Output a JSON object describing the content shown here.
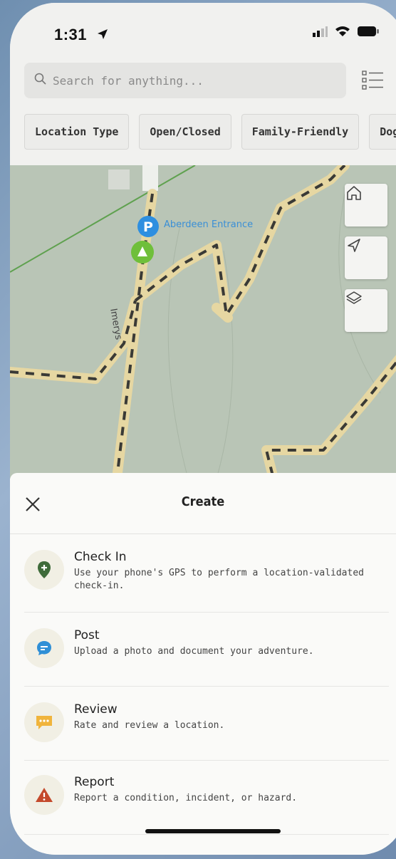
{
  "status": {
    "time": "1:31"
  },
  "search": {
    "placeholder": "Search for anything..."
  },
  "filters": [
    "Location Type",
    "Open/Closed",
    "Family-Friendly",
    "Dog"
  ],
  "map": {
    "poi_label": "Aberdeen Entrance",
    "poi_letter": "P",
    "road_label": "Imerys"
  },
  "sheet": {
    "title": "Create",
    "items": [
      {
        "title": "Check In",
        "desc": "Use your phone's GPS to perform a location-validated check-in.",
        "icon": "map-pin-plus-icon",
        "color": "#3f6b3a"
      },
      {
        "title": "Post",
        "desc": "Upload a photo and document your adventure.",
        "icon": "chat-bubble-icon",
        "color": "#2f8fd6"
      },
      {
        "title": "Review",
        "desc": "Rate and review a location.",
        "icon": "review-bubble-icon",
        "color": "#f0b43c"
      },
      {
        "title": "Report",
        "desc": "Report a condition, incident, or hazard.",
        "icon": "warning-triangle-icon",
        "color": "#c44a2c"
      }
    ]
  },
  "colors": {
    "accent_green": "#3f6b3a",
    "map_bg": "#b7c3b4",
    "trail": "#e8d9a4"
  }
}
